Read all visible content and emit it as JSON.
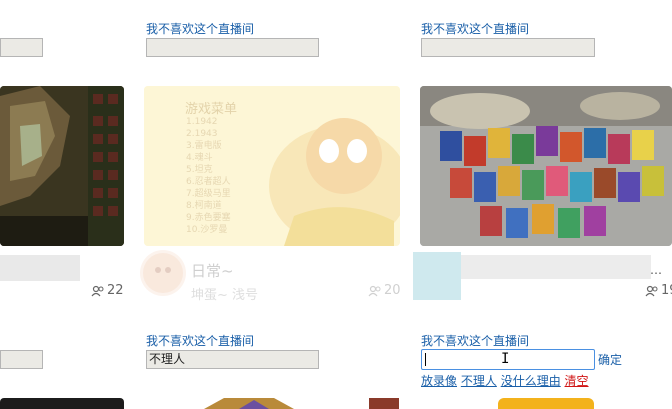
{
  "cards_top": {
    "dislike_labels": [
      "我不喜欢这个直播间",
      "我不喜欢这个直播间"
    ]
  },
  "cards": [
    {
      "viewer_count": "22"
    },
    {
      "title": "日常~",
      "subtitle": "坤蛋~ 浅号",
      "viewer_count": "20",
      "menu_title": "游戏菜单",
      "menu_items": [
        "1.1942",
        "2.1943",
        "3.雷电版",
        "4.魂斗",
        "5.坦克",
        "6.忍者超人",
        "7.超级马里",
        "8.柯南道",
        "9.赤色要塞",
        "10.沙罗曼"
      ]
    },
    {
      "viewer_count": "19",
      "more": "…"
    }
  ],
  "cards_bottom": {
    "dislike_labels": [
      "我不喜欢这个直播间",
      "我不喜欢这个直播间"
    ],
    "middle_reason_value": "不理人",
    "right_reason_value": "",
    "confirm_label": "确定",
    "quick_reasons": [
      "放录像",
      "不理人",
      "没什么理由",
      "清空"
    ]
  },
  "colors": {
    "link": "#1a5fa8",
    "clear": "#d01414",
    "input_bg": "#ebeae5",
    "focus_border": "#4a90e2"
  }
}
